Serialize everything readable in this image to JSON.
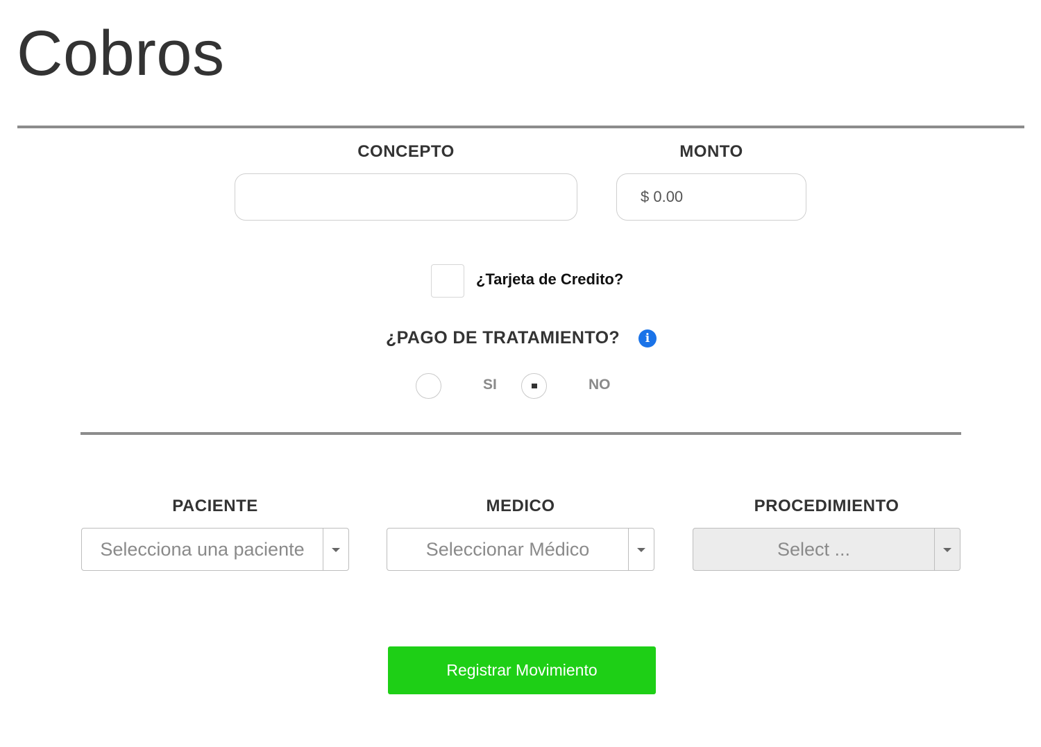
{
  "page": {
    "title": "Cobros"
  },
  "form": {
    "concepto": {
      "label": "CONCEPTO",
      "value": "",
      "placeholder": ""
    },
    "monto": {
      "label": "MONTO",
      "value": "",
      "placeholder": "$ 0.00"
    },
    "tarjeta_credito": {
      "label": "¿Tarjeta de Credito?",
      "checked": false
    },
    "pago_tratamiento": {
      "label": "¿PAGO DE TRATAMIENTO?",
      "info_icon": "info-circle-icon",
      "options": [
        {
          "label": "SI",
          "selected": false
        },
        {
          "label": "NO",
          "selected": true
        }
      ]
    },
    "paciente": {
      "label": "PACIENTE",
      "placeholder": "Selecciona una paciente"
    },
    "medico": {
      "label": "MEDICO",
      "placeholder": "Seleccionar Médico"
    },
    "procedimiento": {
      "label": "PROCEDIMIENTO",
      "placeholder": "Select ...",
      "disabled": true
    },
    "submit": {
      "label": "Registrar Movimiento"
    }
  },
  "colors": {
    "accent_button": "#1ecf16",
    "info_icon": "#1a73e8",
    "divider": "#8c8c8c"
  }
}
